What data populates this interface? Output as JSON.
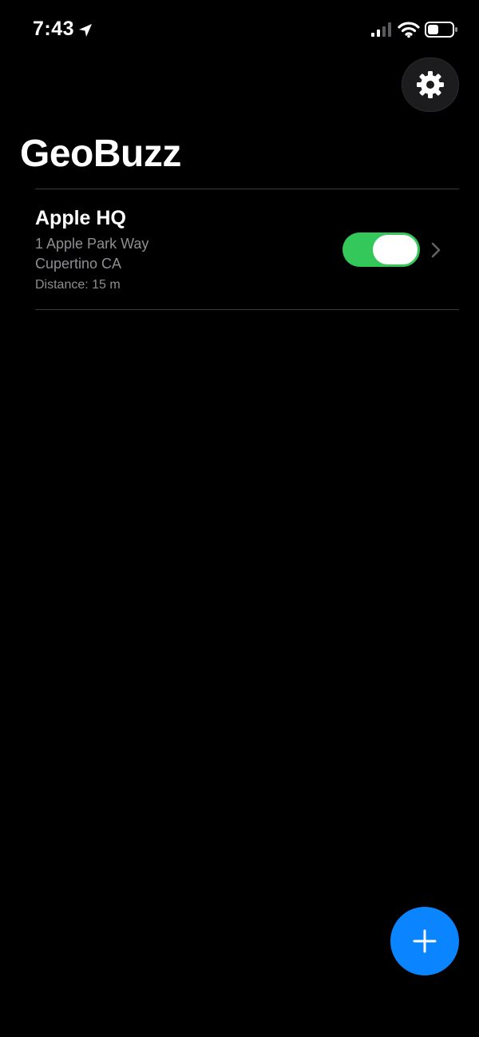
{
  "status_bar": {
    "time": "7:43",
    "icons": [
      "location-arrow-icon",
      "signal-icon",
      "wifi-icon",
      "battery-icon"
    ]
  },
  "header": {
    "title": "GeoBuzz",
    "settings_icon": "gear-icon"
  },
  "locations": [
    {
      "name": "Apple HQ",
      "address_line1": "1 Apple Park Way",
      "address_line2": "Cupertino CA",
      "distance": "Distance: 15 m",
      "enabled": true
    }
  ],
  "fab": {
    "icon": "plus-icon"
  },
  "colors": {
    "background": "#000000",
    "toggle_on": "#34c759",
    "accent": "#0a84ff",
    "secondary_text": "#8e8e93",
    "divider": "#3a3a3c"
  }
}
